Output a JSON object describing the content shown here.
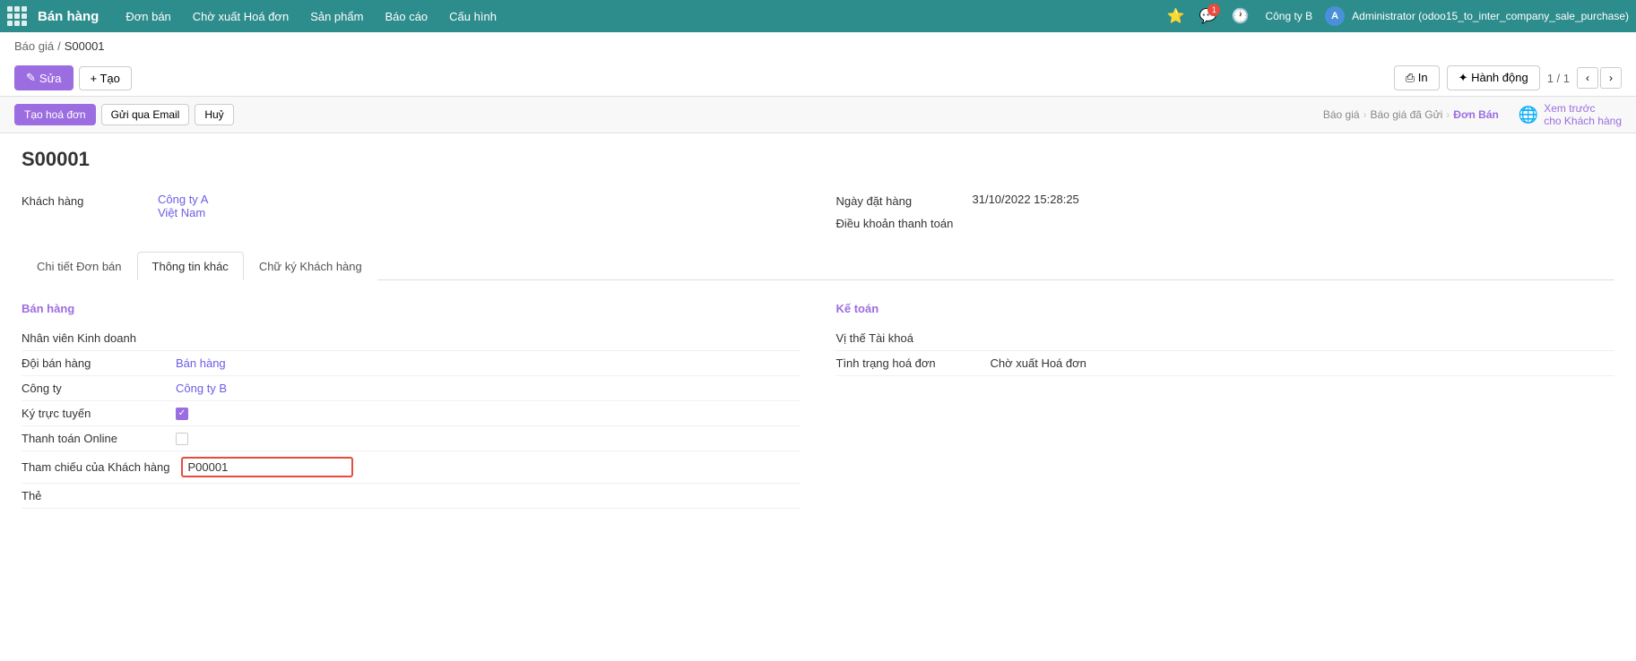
{
  "topNav": {
    "brand": "Bán hàng",
    "items": [
      {
        "label": "Đơn bán"
      },
      {
        "label": "Chờ xuất Hoá đơn"
      },
      {
        "label": "Sản phẩm"
      },
      {
        "label": "Báo cáo"
      },
      {
        "label": "Cấu hình"
      }
    ],
    "company": "Công ty B",
    "userInitial": "A",
    "userName": "Administrator (odoo15_to_inter_company_sale_purchase)"
  },
  "breadcrumb": {
    "parent": "Báo giá",
    "separator": "/",
    "current": "S00001"
  },
  "toolbar": {
    "edit_label": "Sửa",
    "create_label": "+ Tạo",
    "print_label": "⎙ In",
    "action_label": "✦ Hành động",
    "pagination": "1 / 1"
  },
  "statusBar": {
    "create_invoice_label": "Tạo hoá đơn",
    "send_email_label": "Gửi qua Email",
    "cancel_label": "Huỷ",
    "steps": [
      {
        "label": "Báo giá",
        "active": false
      },
      {
        "label": "Báo giá đã Gửi",
        "active": false
      },
      {
        "label": "Đơn Bán",
        "active": true
      }
    ],
    "preview_label": "Xem trước\ncho Khách hàng"
  },
  "document": {
    "title": "S00001",
    "fields": {
      "left": [
        {
          "label": "Khách hàng",
          "value": "Công ty A\nViệt Nam",
          "multiline": true
        }
      ],
      "right": [
        {
          "label": "Ngày đặt hàng",
          "value": "31/10/2022 15:28:25"
        },
        {
          "label": "Điều khoản thanh toán",
          "value": ""
        }
      ]
    }
  },
  "tabs": [
    {
      "label": "Chi tiết Đơn bán",
      "active": false
    },
    {
      "label": "Thông tin khác",
      "active": true
    },
    {
      "label": "Chữ ký Khách hàng",
      "active": false
    }
  ],
  "tabContent": {
    "sections": {
      "left": {
        "title": "Bán hàng",
        "fields": [
          {
            "label": "Nhân viên Kinh doanh",
            "value": "",
            "type": "text"
          },
          {
            "label": "Đội bán hàng",
            "value": "Bán hàng",
            "type": "link"
          },
          {
            "label": "Công ty",
            "value": "Công ty B",
            "type": "link"
          },
          {
            "label": "Ký trực tuyến",
            "value": "checked",
            "type": "checkbox"
          },
          {
            "label": "Thanh toán Online",
            "value": "unchecked",
            "type": "checkbox"
          },
          {
            "label": "Tham chiếu của Khách hàng",
            "value": "P00001",
            "type": "input-highlighted"
          },
          {
            "label": "Thẻ",
            "value": "",
            "type": "text"
          }
        ]
      },
      "right": {
        "title": "Kế toán",
        "fields": [
          {
            "label": "Vị thế Tài khoá",
            "value": "",
            "type": "text"
          },
          {
            "label": "Tình trạng hoá đơn",
            "value": "Chờ xuất Hoá đơn",
            "type": "text"
          }
        ]
      }
    }
  },
  "bottomText": "Thẻ"
}
